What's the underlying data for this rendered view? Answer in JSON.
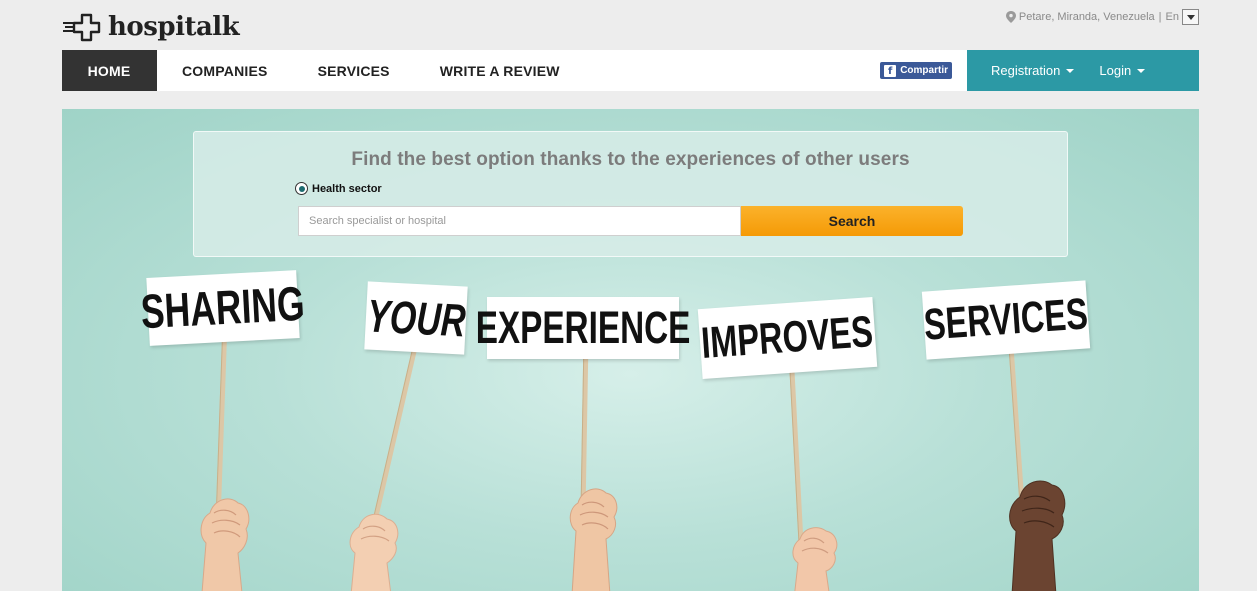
{
  "brand": {
    "name": "hospitalk",
    "logo_icon": "hospital-cross-logo-icon"
  },
  "locale": {
    "location": "Petare, Miranda, Venezuela",
    "separator": "|",
    "language": "En"
  },
  "nav": {
    "items": [
      {
        "label": "HOME",
        "active": true
      },
      {
        "label": "COMPANIES",
        "active": false
      },
      {
        "label": "SERVICES",
        "active": false
      },
      {
        "label": "WRITE A REVIEW",
        "active": false
      }
    ],
    "share_label": "Compartir",
    "registration_label": "Registration",
    "login_label": "Login"
  },
  "search": {
    "title": "Find the best option thanks to the experiences of other users",
    "sector_label": "Health sector",
    "placeholder": "Search specialist or hospital",
    "button_label": "Search"
  },
  "hero_signs": [
    "SHARING",
    "YOUR",
    "EXPERIENCE",
    "IMPROVES",
    "SERVICES"
  ],
  "colors": {
    "accent": "#2c99a5",
    "nav_active": "#333333",
    "search_button": "#f8a514",
    "facebook": "#3b5998"
  }
}
